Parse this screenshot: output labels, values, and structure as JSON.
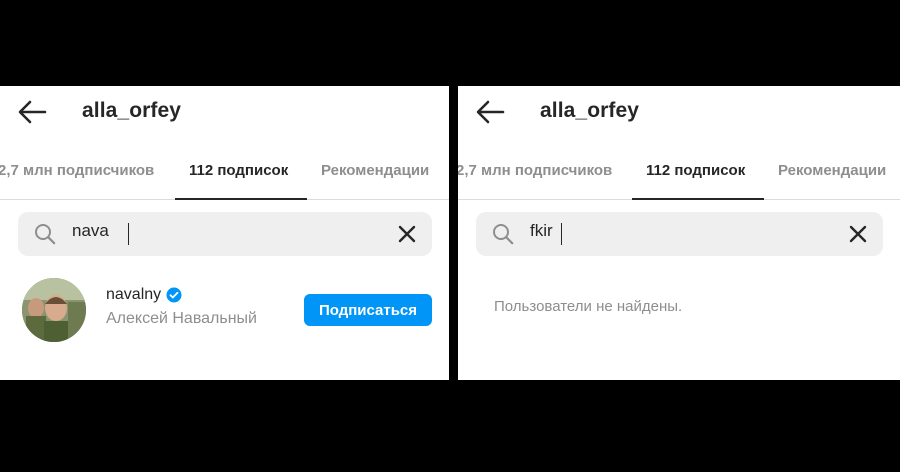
{
  "left": {
    "title": "alla_orfey",
    "tabs": [
      {
        "label": "2,7 млн подписчиков",
        "active": false
      },
      {
        "label": "112 подписок",
        "active": true
      },
      {
        "label": "Рекомендации",
        "active": false
      }
    ],
    "search": {
      "value": "nava",
      "icon": "search-icon",
      "clear_icon": "close-icon"
    },
    "result": {
      "username": "navalny",
      "verified": true,
      "full_name": "Алексей Навальный",
      "follow_label": "Подписаться"
    }
  },
  "right": {
    "title": "alla_orfey",
    "tabs": [
      {
        "label": "2,7 млн подписчиков",
        "active": false
      },
      {
        "label": "112 подписок",
        "active": true
      },
      {
        "label": "Рекомендации",
        "active": false
      }
    ],
    "search": {
      "value": "fkir",
      "icon": "search-icon",
      "clear_icon": "close-icon"
    },
    "empty_message": "Пользователи не найдены."
  },
  "colors": {
    "accent": "#0095f6",
    "text_primary": "#262626",
    "text_secondary": "#8e8e8e",
    "search_bg": "#efefef",
    "background_bars": "#000000"
  }
}
